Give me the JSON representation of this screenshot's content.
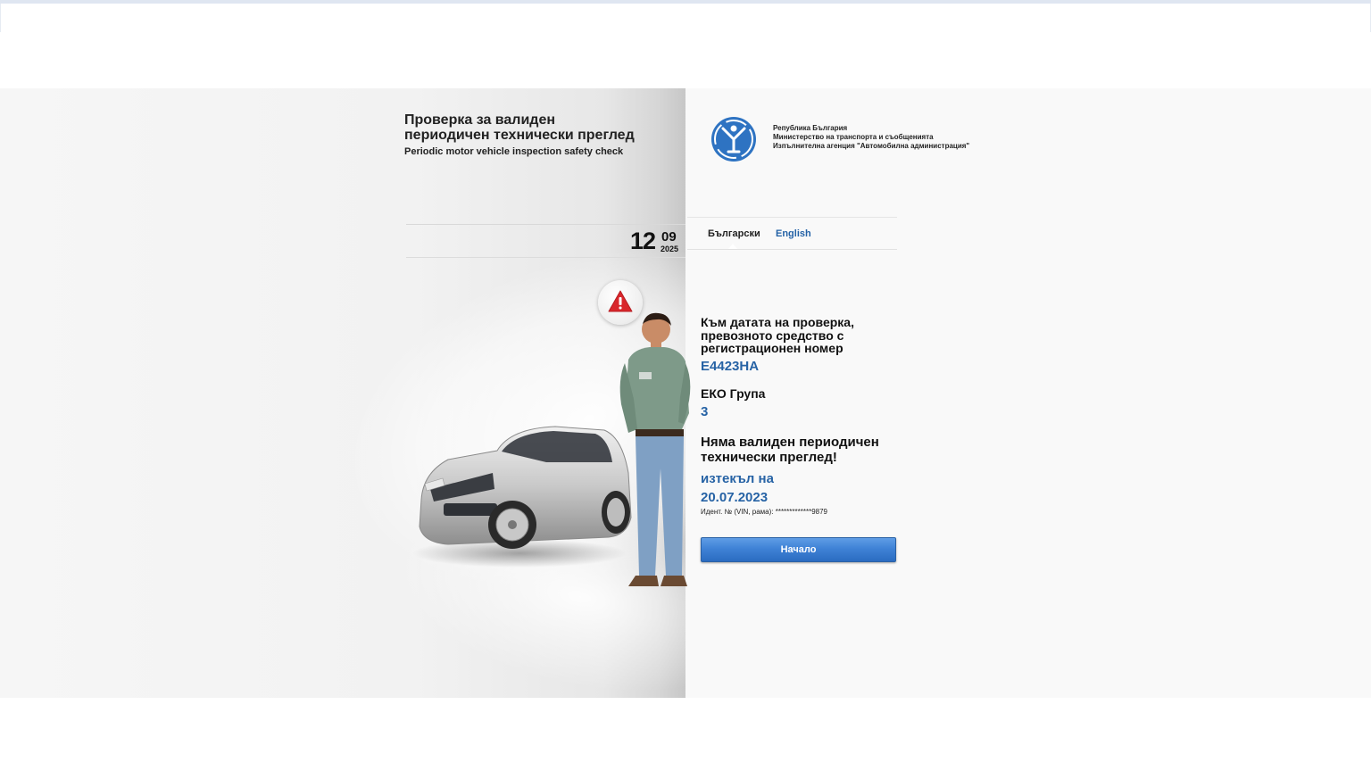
{
  "header": {
    "title_bg_line1": "Проверка за валиден",
    "title_bg_line2": "периодичен технически преглед",
    "title_en": "Periodic motor vehicle inspection safety check"
  },
  "date": {
    "day": "12",
    "month": "09",
    "year": "2025"
  },
  "agency": {
    "line1": "Република България",
    "line2": "Министерство на транспорта и съобщенията",
    "line3": "Изпълнителна агенция \"Автомобилна администрация\""
  },
  "languages": {
    "bulgarian": "Български",
    "english": "English"
  },
  "result": {
    "label_line1": "Към датата на проверка,",
    "label_line2": "превозното средство с",
    "label_line3": "регистрационен номер",
    "plate": "Е4423НА",
    "eco_label": "ЕКО Група",
    "eco_value": "3",
    "warning_line1": "Няма валиден периодичен",
    "warning_line2": "технически преглед!",
    "expired_label": "изтекъл на",
    "expired_date": "20.07.2023",
    "vin_text": "Идент. № (VIN, рама): *************9879"
  },
  "buttons": {
    "start_label": "Начало"
  },
  "colors": {
    "accent_blue": "#2763a5",
    "button_blue": "#3f82d6",
    "warning_red": "#d9262b"
  },
  "icons": {
    "logo": "agency-logo-icon",
    "warning": "warning-icon"
  }
}
